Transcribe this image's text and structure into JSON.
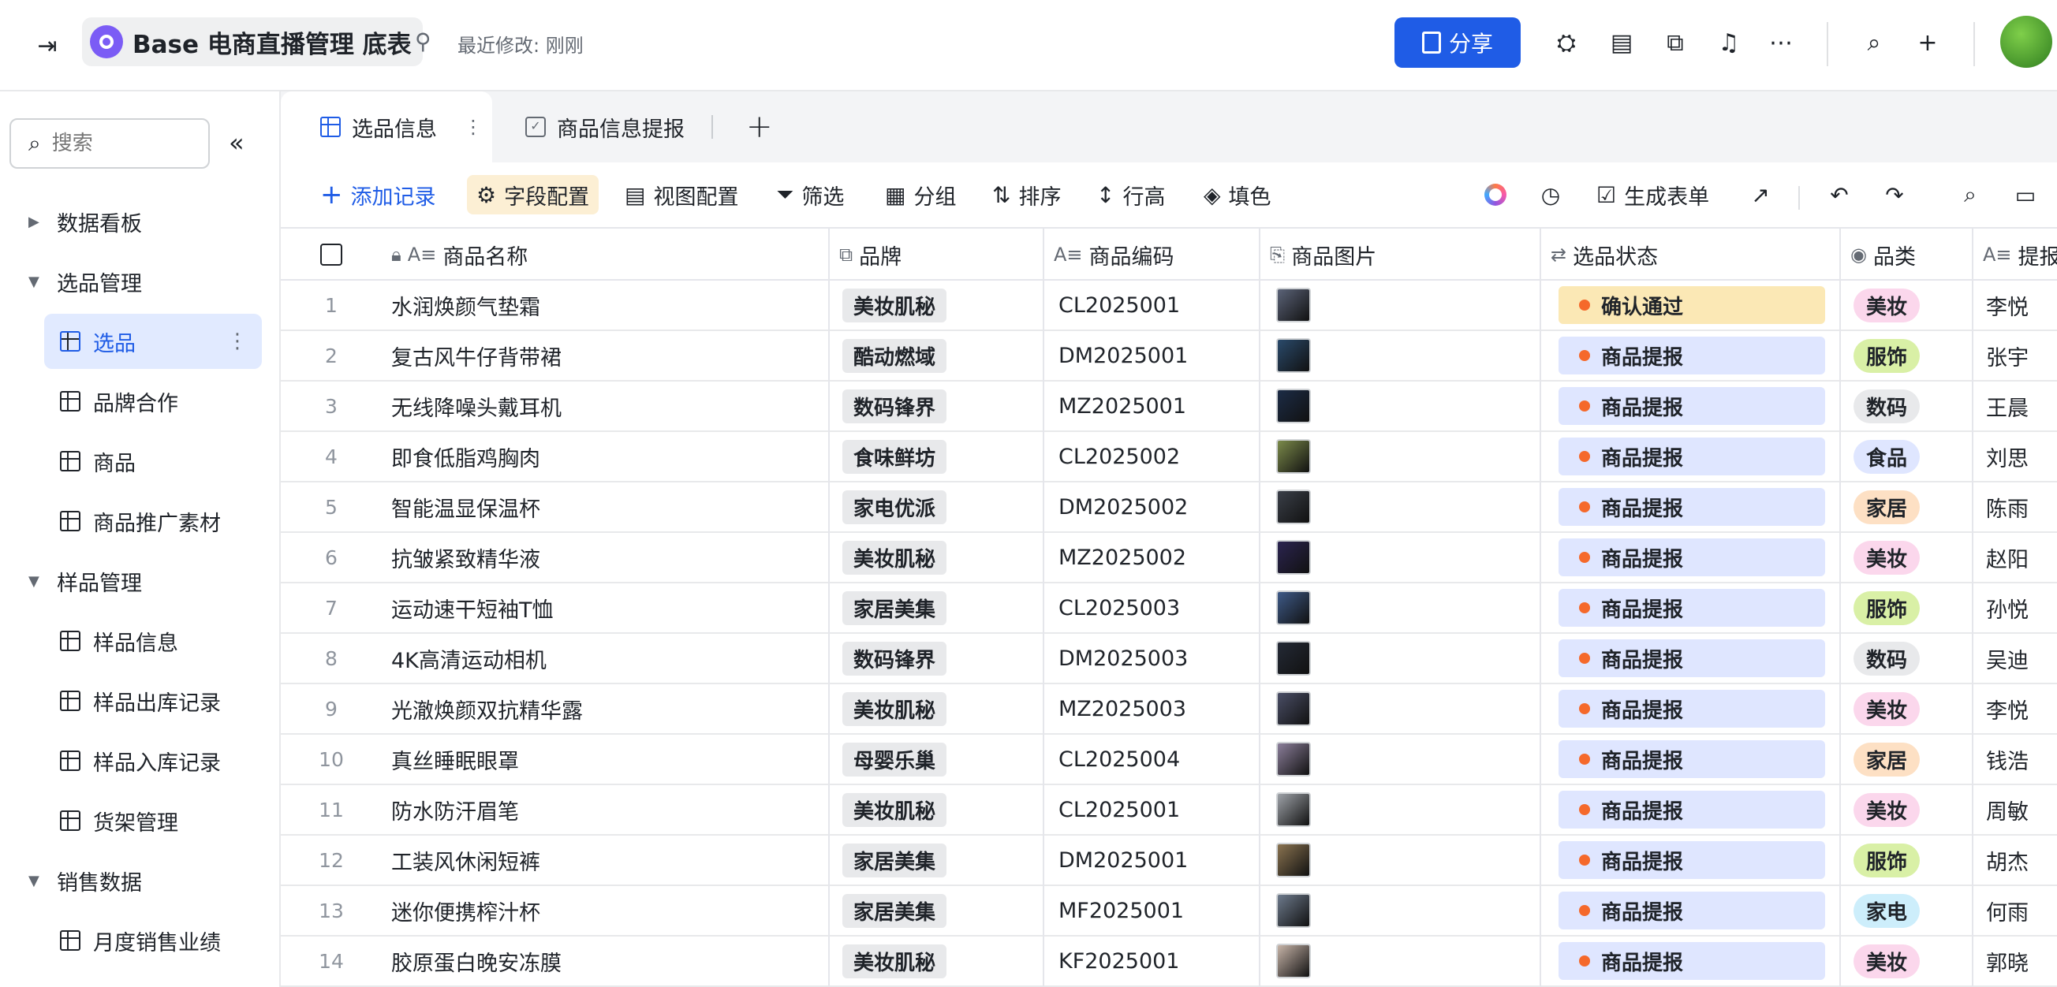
{
  "topbar": {
    "title": "Base 电商直播管理 底表",
    "last_modified": "最近修改: 刚刚",
    "share_label": "分享"
  },
  "sidebar": {
    "search_placeholder": "搜索",
    "items": [
      {
        "label": "数据看板",
        "type": "group",
        "expanded": false
      },
      {
        "label": "选品管理",
        "type": "group",
        "expanded": true
      },
      {
        "label": "选品",
        "type": "table",
        "active": true
      },
      {
        "label": "品牌合作",
        "type": "table"
      },
      {
        "label": "商品",
        "type": "table"
      },
      {
        "label": "商品推广素材",
        "type": "table"
      },
      {
        "label": "样品管理",
        "type": "group",
        "expanded": true
      },
      {
        "label": "样品信息",
        "type": "table"
      },
      {
        "label": "样品出库记录",
        "type": "table"
      },
      {
        "label": "样品入库记录",
        "type": "table"
      },
      {
        "label": "货架管理",
        "type": "table"
      },
      {
        "label": "销售数据",
        "type": "group",
        "expanded": true
      },
      {
        "label": "月度销售业绩",
        "type": "table"
      }
    ]
  },
  "tabs": [
    {
      "label": "选品信息",
      "active": true
    },
    {
      "label": "商品信息提报",
      "active": false
    }
  ],
  "toolbar": {
    "add_record": "添加记录",
    "field_config": "字段配置",
    "view_config": "视图配置",
    "filter": "筛选",
    "group": "分组",
    "sort": "排序",
    "row_height": "行高",
    "fill": "填色",
    "generate_form": "生成表单"
  },
  "columns": {
    "name": "商品名称",
    "brand": "品牌",
    "code": "商品编码",
    "image": "商品图片",
    "status": "选品状态",
    "category": "品类",
    "reporter": "提报"
  },
  "rows": [
    {
      "num": "1",
      "name": "水润焕颜气垫霜",
      "brand": "美妆肌秘",
      "code": "CL2025001",
      "status": "确认通过",
      "category": "美妆",
      "person": "李悦"
    },
    {
      "num": "2",
      "name": "复古风牛仔背带裙",
      "brand": "酷动燃域",
      "code": "DM2025001",
      "status": "商品提报",
      "category": "服饰",
      "person": "张宇"
    },
    {
      "num": "3",
      "name": "无线降噪头戴耳机",
      "brand": "数码锋界",
      "code": "MZ2025001",
      "status": "商品提报",
      "category": "数码",
      "person": "王晨"
    },
    {
      "num": "4",
      "name": "即食低脂鸡胸肉",
      "brand": "食味鲜坊",
      "code": "CL2025002",
      "status": "商品提报",
      "category": "食品",
      "person": "刘思"
    },
    {
      "num": "5",
      "name": "智能温显保温杯",
      "brand": "家电优派",
      "code": "DM2025002",
      "status": "商品提报",
      "category": "家居",
      "person": "陈雨"
    },
    {
      "num": "6",
      "name": "抗皱紧致精华液",
      "brand": "美妆肌秘",
      "code": "MZ2025002",
      "status": "商品提报",
      "category": "美妆",
      "person": "赵阳"
    },
    {
      "num": "7",
      "name": "运动速干短袖T恤",
      "brand": "家居美集",
      "code": "CL2025003",
      "status": "商品提报",
      "category": "服饰",
      "person": "孙悦"
    },
    {
      "num": "8",
      "name": "4K高清运动相机",
      "brand": "数码锋界",
      "code": "DM2025003",
      "status": "商品提报",
      "category": "数码",
      "person": "吴迪"
    },
    {
      "num": "9",
      "name": "光澈焕颜双抗精华露",
      "brand": "美妆肌秘",
      "code": "MZ2025003",
      "status": "商品提报",
      "category": "美妆",
      "person": "李悦"
    },
    {
      "num": "10",
      "name": "真丝睡眠眼罩",
      "brand": "母婴乐巢",
      "code": "CL2025004",
      "status": "商品提报",
      "category": "家居",
      "person": "钱浩"
    },
    {
      "num": "11",
      "name": "防水防汗眉笔",
      "brand": "美妆肌秘",
      "code": "CL2025001",
      "status": "商品提报",
      "category": "美妆",
      "person": "周敏"
    },
    {
      "num": "12",
      "name": "工装风休闲短裤",
      "brand": "家居美集",
      "code": "DM2025001",
      "status": "商品提报",
      "category": "服饰",
      "person": "胡杰"
    },
    {
      "num": "13",
      "name": "迷你便携榨汁杯",
      "brand": "家居美集",
      "code": "MF2025001",
      "status": "商品提报",
      "category": "家电",
      "person": "何雨"
    },
    {
      "num": "14",
      "name": "胶原蛋白晚安冻膜",
      "brand": "美妆肌秘",
      "code": "KF2025001",
      "status": "商品提报",
      "category": "美妆",
      "person": "郭晓"
    }
  ],
  "colors": {
    "accent": "#1f5ce6",
    "status_approved_bg": "#fbe8b5",
    "status_report_bg": "#dfe6ff",
    "status_dot": "#f5692b",
    "cat_美妆": "#fbd7ec",
    "cat_服饰": "#d9f0a6",
    "cat_数码": "#e8e9eb",
    "cat_食品": "#dfe6ff",
    "cat_家居": "#fde0c4",
    "cat_家电": "#cdeefb"
  }
}
